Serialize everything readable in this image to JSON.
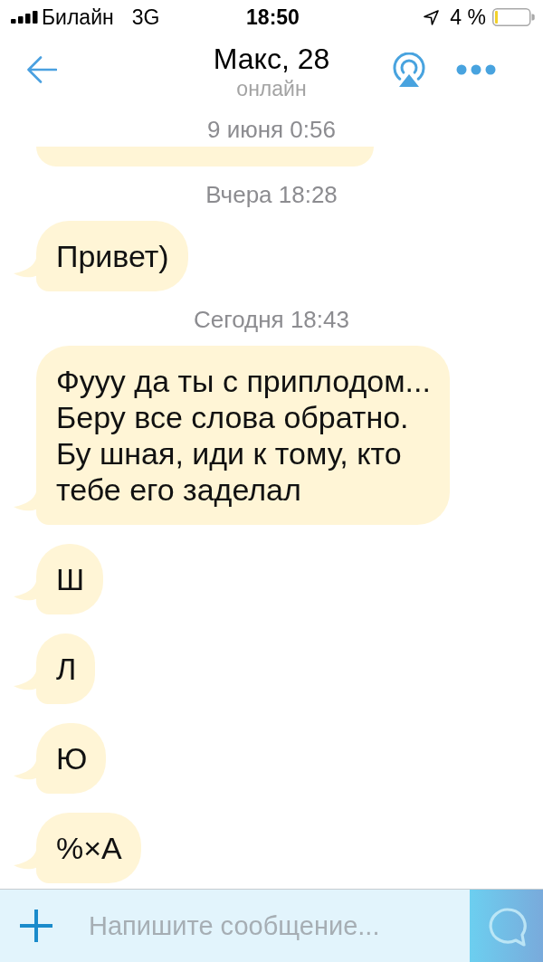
{
  "status_bar": {
    "carrier": "Билайн",
    "network": "3G",
    "time": "18:50",
    "battery": "4 %"
  },
  "header": {
    "title": "Макс, 28",
    "subtitle": "онлайн"
  },
  "messages": [
    {
      "kind": "date",
      "text": "9 июня 0:56"
    },
    {
      "kind": "clipped"
    },
    {
      "kind": "date",
      "text": "Вчера 18:28"
    },
    {
      "kind": "incoming",
      "text": "Привет)"
    },
    {
      "kind": "date",
      "text": "Сегодня 18:43"
    },
    {
      "kind": "incoming",
      "text": "Фууу да ты с приплодом...\nБеру все слова обратно.\nБу шная, иди к тому, кто\nтебе его заделал"
    },
    {
      "kind": "incoming",
      "text": "Ш"
    },
    {
      "kind": "incoming",
      "text": "Л"
    },
    {
      "kind": "incoming",
      "text": "Ю"
    },
    {
      "kind": "incoming",
      "text": "%×А"
    }
  ],
  "composer": {
    "placeholder": "Напишите сообщение..."
  }
}
